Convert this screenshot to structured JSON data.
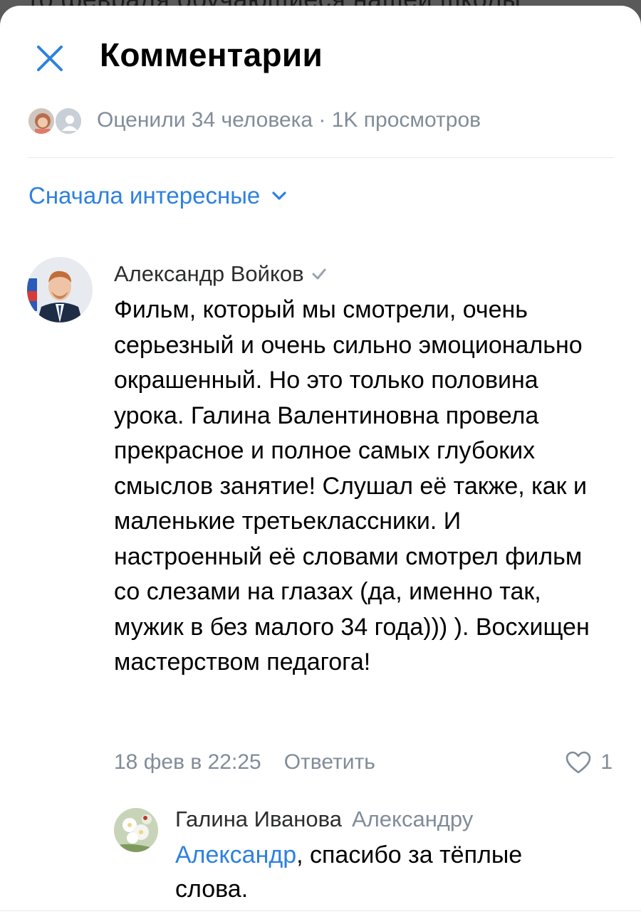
{
  "background_text": "то февраля обучающиеся нашей школы",
  "header": {
    "title": "Комментарии",
    "close_icon": "close-icon"
  },
  "stats": {
    "text": "Оценили 34 человека · 1K просмотров"
  },
  "sort": {
    "label": "Сначала интересные",
    "icon": "chevron-down-icon"
  },
  "comment": {
    "author": "Александр Войков",
    "verified_icon": "checkmark-icon",
    "text": "Фильм, который мы смотрели, очень серьезный и очень сильно эмоционально окрашенный. Но это только половина урока. Галина Валентиновна провела прекрасное и полное самых глубоких смыслов занятие! Слушал её также, как и маленькие третьеклассники. И настроенный её словами смотрел фильм со слезами на глазах (да, именно так, мужик в без малого 34 года))) ). Восхищен мастерством педагога!",
    "date": "18 фев в 22:25",
    "reply_label": "Ответить",
    "likes": "1"
  },
  "reply": {
    "author": "Галина Иванова",
    "to": "Александру",
    "mention": "Александр",
    "text": ", спасибо за тёплые слова."
  },
  "colors": {
    "accent": "#2d81e0",
    "secondary_text": "#818c99",
    "verified": "#99a2ad"
  }
}
